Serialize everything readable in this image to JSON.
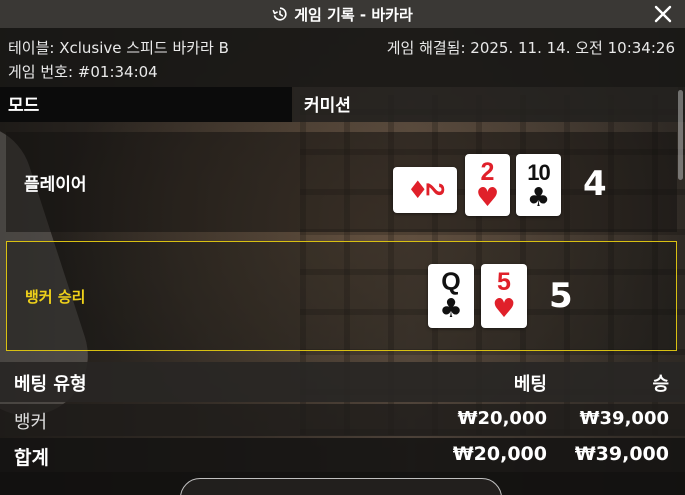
{
  "window": {
    "title": "게임 기록 - 바카라",
    "title_icon": "history-icon",
    "close_icon": "close-icon"
  },
  "info": {
    "table_name": "테이블: Xclusive 스피드 바카라 B",
    "game_number": "게임 번호: #01:34:04",
    "resolved": "게임 해결됨: 2025. 11. 14. 오전 10:34:26"
  },
  "mode": {
    "label": "모드",
    "value": "커미션"
  },
  "player": {
    "label": "플레이어",
    "score": "4",
    "cards": [
      {
        "rank": "2",
        "suit": "diamonds",
        "symbol": "♦",
        "color": "#e0202a",
        "sideways": true
      },
      {
        "rank": "2",
        "suit": "hearts",
        "symbol": "♥",
        "color": "#e0202a",
        "sideways": false
      },
      {
        "rank": "10",
        "suit": "clubs",
        "symbol": "♣",
        "color": "#111111",
        "sideways": false
      }
    ]
  },
  "banker": {
    "label": "뱅커 승리",
    "score": "5",
    "highlight_color": "#d8c012",
    "cards": [
      {
        "rank": "Q",
        "suit": "clubs",
        "symbol": "♣",
        "color": "#111111",
        "sideways": false
      },
      {
        "rank": "5",
        "suit": "hearts",
        "symbol": "♥",
        "color": "#e0202a",
        "sideways": false
      }
    ]
  },
  "bets": {
    "headers": {
      "type": "베팅 유형",
      "bet": "베팅",
      "win": "승"
    },
    "rows": [
      {
        "type": "뱅커",
        "bet": "₩20,000",
        "win": "₩39,000"
      }
    ],
    "total": {
      "type": "합계",
      "bet": "₩20,000",
      "win": "₩39,000"
    }
  }
}
